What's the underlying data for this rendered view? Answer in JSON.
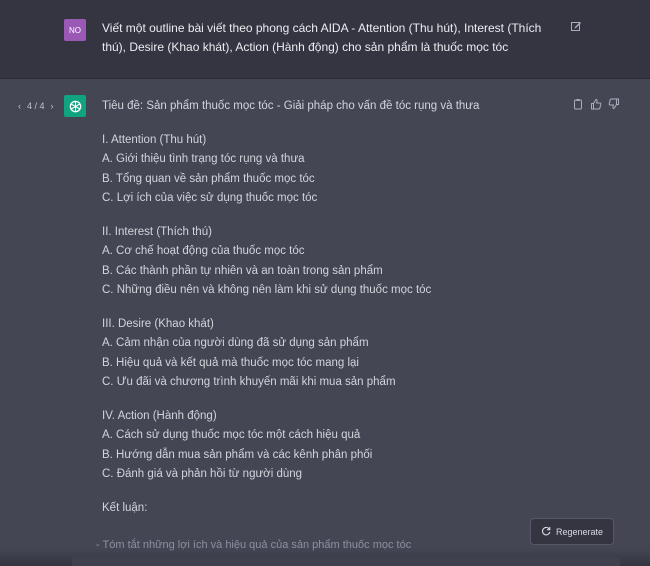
{
  "user": {
    "avatar": "NO",
    "message": "Viết một outline bài viết theo phong cách AIDA - Attention (Thu hút), Interest (Thích thú), Desire (Khao khát), Action (Hành động) cho sản phẩm là thuốc mọc tóc",
    "edit_icon": "edit-icon"
  },
  "assistant": {
    "pager": {
      "prev": "‹",
      "label": "4 / 4",
      "next": "›"
    },
    "avatar_icon": "openai-logo",
    "lines": [
      "Tiêu đề: Sản phẩm thuốc mọc tóc - Giải pháp cho vấn đề tóc rụng và thưa",
      "",
      "I. Attention (Thu hút)",
      "A. Giới thiệu tình trạng tóc rụng và thưa",
      "B. Tổng quan về sản phẩm thuốc mọc tóc",
      "C. Lợi ích của việc sử dụng thuốc mọc tóc",
      "",
      "II. Interest (Thích thú)",
      "A. Cơ chế hoạt động của thuốc mọc tóc",
      "B. Các thành phần tự nhiên và an toàn trong sản phẩm",
      "C. Những điều nên và không nên làm khi sử dụng thuốc mọc tóc",
      "",
      "III. Desire (Khao khát)",
      "A. Cảm nhận của người dùng đã sử dụng sản phẩm",
      "B. Hiệu quả và kết quả mà thuốc mọc tóc mang lại",
      "C. Ưu đãi và chương trình khuyến mãi khi mua sản phẩm",
      "",
      "IV. Action (Hành động)",
      "A. Cách sử dụng thuốc mọc tóc một cách hiệu quả",
      "B. Hướng dẫn mua sản phẩm và các kênh phân phối",
      "C. Đánh giá và phản hồi từ người dùng",
      "",
      "Kết luận:"
    ],
    "faded_line": "- Tóm tắt những lợi ích và hiệu quả của sản phẩm thuốc mọc tóc",
    "actions": [
      "copy-icon",
      "thumbs-up-icon",
      "thumbs-down-icon"
    ]
  },
  "regenerate": {
    "label": "Regenerate",
    "icon": "refresh-icon"
  },
  "colors": {
    "user_bg": "#343541",
    "assistant_bg": "#444654",
    "gpt_green": "#10a37f",
    "user_avatar": "#9b59b6"
  }
}
